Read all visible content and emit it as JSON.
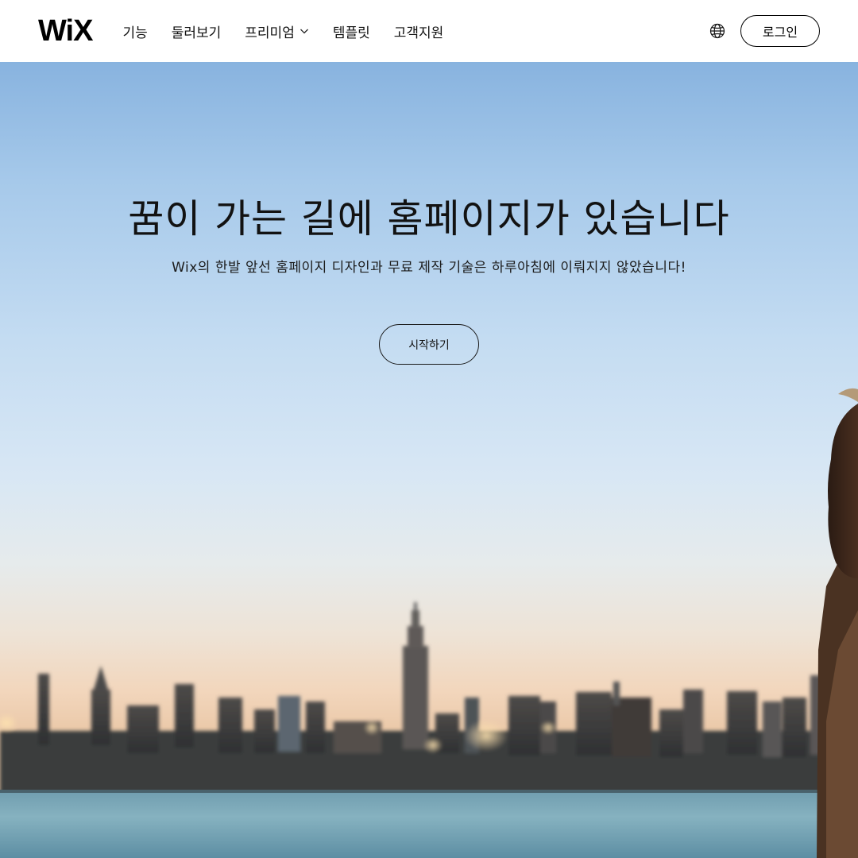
{
  "brand": {
    "logo_text": "WiX"
  },
  "nav": {
    "items": [
      {
        "label": "기능"
      },
      {
        "label": "둘러보기"
      },
      {
        "label": "프리미엄",
        "has_dropdown": true,
        "icon": "chevron-down-icon"
      },
      {
        "label": "템플릿"
      },
      {
        "label": "고객지원"
      }
    ]
  },
  "header": {
    "language_icon": "globe-icon",
    "login_label": "로그인"
  },
  "hero": {
    "title": "꿈이 가는 길에 홈페이지가 있습니다",
    "subtitle": "Wix의 한발 앞선 홈페이지 디자인과 무료 제작 기술은 하루아침에 이뤄지지 않았습니다!",
    "cta_label": "시작하기"
  },
  "colors": {
    "sky_top": "#88b3df",
    "horizon": "#f2d6bc",
    "water": "#7fa9b8",
    "text": "#121212"
  }
}
